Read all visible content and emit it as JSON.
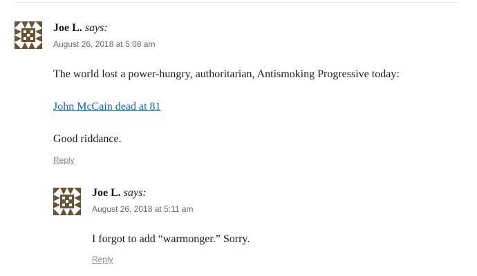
{
  "comments": [
    {
      "author": "Joe L.",
      "says": "says:",
      "date": "August 26, 2018 at 5:08 am",
      "paragraphs": [
        "The world lost a power-hungry, authoritarian, Antismoking Progressive today:",
        "Good riddance."
      ],
      "link_text": "John McCain dead at 81",
      "reply_label": "Reply",
      "avatar_icon": "identicon-avatar",
      "avatar_color": "#6b5236"
    },
    {
      "author": "Joe L.",
      "says": "says:",
      "date": "August 26, 2018 at 5:11 am",
      "paragraphs": [
        "I forgot to add “warmonger.” Sorry."
      ],
      "reply_label": "Reply",
      "avatar_icon": "identicon-avatar",
      "avatar_color": "#6b5236"
    }
  ],
  "colors": {
    "link": "#1a63b8",
    "meta": "#6b6b6b",
    "reply": "#8a8a8a"
  }
}
